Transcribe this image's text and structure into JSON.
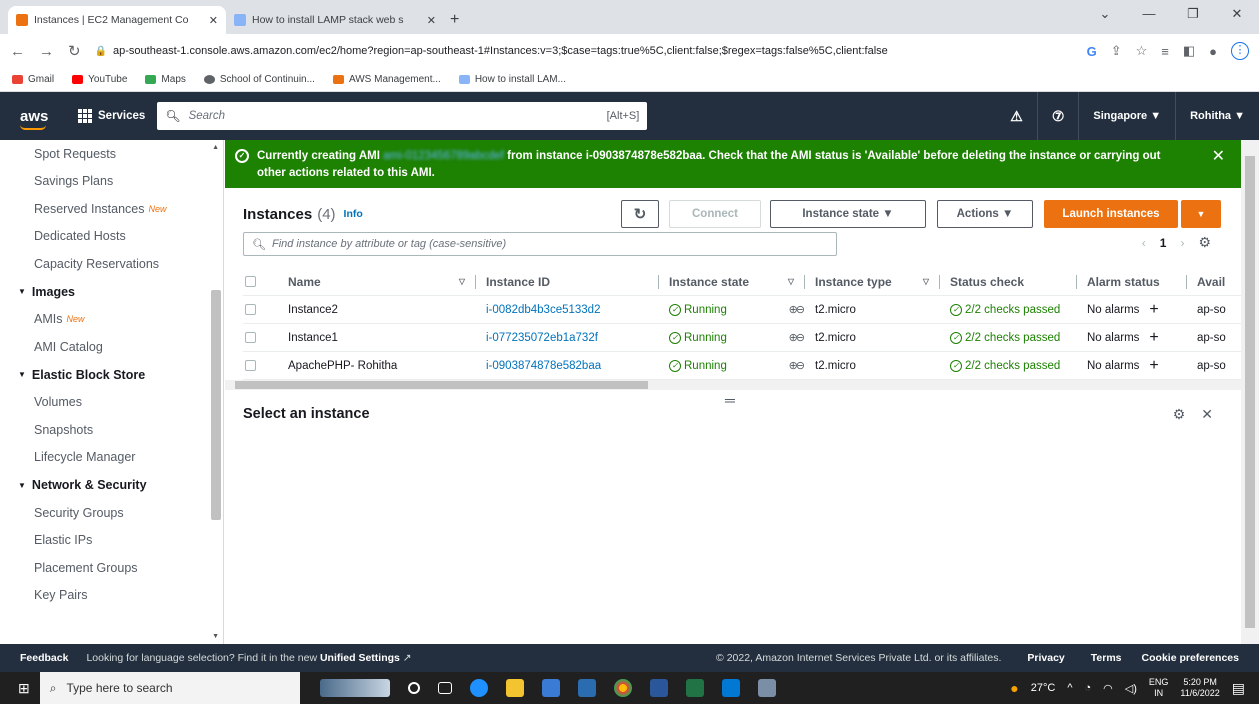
{
  "browser": {
    "tabs": [
      {
        "title": "Instances | EC2 Management Co",
        "active": true
      },
      {
        "title": "How to install LAMP stack web s",
        "active": false
      }
    ],
    "url": "ap-southeast-1.console.aws.amazon.com/ec2/home?region=ap-southeast-1#Instances:v=3;$case=tags:true%5C,client:false;$regex=tags:false%5C,client:false",
    "bookmarks": [
      "Gmail",
      "YouTube",
      "Maps",
      "School of Continuin...",
      "AWS Management...",
      "How to install LAM..."
    ]
  },
  "aws_header": {
    "logo": "aws",
    "services": "Services",
    "search_placeholder": "Search",
    "search_shortcut": "[Alt+S]",
    "region": "Singapore ▼",
    "user": "Rohitha ▼"
  },
  "sidebar": {
    "items": [
      {
        "label": "Spot Requests",
        "type": "item"
      },
      {
        "label": "Savings Plans",
        "type": "item"
      },
      {
        "label": "Reserved Instances",
        "type": "item",
        "badge": "New"
      },
      {
        "label": "Dedicated Hosts",
        "type": "item"
      },
      {
        "label": "Capacity Reservations",
        "type": "item"
      },
      {
        "label": "Images",
        "type": "head"
      },
      {
        "label": "AMIs",
        "type": "item",
        "badge": "New"
      },
      {
        "label": "AMI Catalog",
        "type": "item"
      },
      {
        "label": "Elastic Block Store",
        "type": "head"
      },
      {
        "label": "Volumes",
        "type": "item"
      },
      {
        "label": "Snapshots",
        "type": "item"
      },
      {
        "label": "Lifecycle Manager",
        "type": "item"
      },
      {
        "label": "Network & Security",
        "type": "head"
      },
      {
        "label": "Security Groups",
        "type": "item"
      },
      {
        "label": "Elastic IPs",
        "type": "item"
      },
      {
        "label": "Placement Groups",
        "type": "item"
      },
      {
        "label": "Key Pairs",
        "type": "item"
      }
    ]
  },
  "flash": {
    "prefix": "Currently creating AMI",
    "ami_id": "ami-0123456789abcdef",
    "suffix": "from instance i-0903874878e582baa. Check that the AMI status is 'Available' before deleting the instance or carrying out other actions related to this AMI.",
    "color": "#1d8102"
  },
  "instances": {
    "title": "Instances",
    "count": "(4)",
    "info": "Info",
    "buttons": {
      "refresh": "↻",
      "connect": "Connect",
      "state": "Instance state ▼",
      "actions": "Actions ▼",
      "launch": "Launch instances",
      "launch_menu": "▼"
    },
    "filter_placeholder": "Find instance by attribute or tag (case-sensitive)",
    "page": "1",
    "columns": [
      "Name",
      "Instance ID",
      "Instance state",
      "Instance type",
      "Status check",
      "Alarm status",
      "Avail"
    ],
    "rows": [
      {
        "name": "Instance2",
        "id": "i-0082db4b3ce5133d2",
        "state": "Running",
        "type": "t2.micro",
        "status": "2/2 checks passed",
        "alarm": "No alarms",
        "az": "ap-so"
      },
      {
        "name": "Instance1",
        "id": "i-077235072eb1a732f",
        "state": "Running",
        "type": "t2.micro",
        "status": "2/2 checks passed",
        "alarm": "No alarms",
        "az": "ap-so"
      },
      {
        "name": "ApachePHP- Rohitha",
        "id": "i-0903874878e582baa",
        "state": "Running",
        "type": "t2.micro",
        "status": "2/2 checks passed",
        "alarm": "No alarms",
        "az": "ap-so"
      }
    ],
    "select_prompt": "Select an instance"
  },
  "footer": {
    "feedback": "Feedback",
    "lang_msg": "Looking for language selection? Find it in the new",
    "lang_link": "Unified Settings",
    "copyright": "© 2022, Amazon Internet Services Private Ltd. or its affiliates.",
    "links": [
      "Privacy",
      "Terms",
      "Cookie preferences"
    ]
  },
  "taskbar": {
    "search": "Type here to search",
    "temp": "27°C",
    "lang": "ENG",
    "region": "IN",
    "time": "5:20 PM",
    "date": "11/6/2022"
  },
  "colors": {
    "aws_nav": "#232f3e",
    "accent": "#ec7211",
    "link": "#0073bb",
    "success": "#1d8102"
  }
}
